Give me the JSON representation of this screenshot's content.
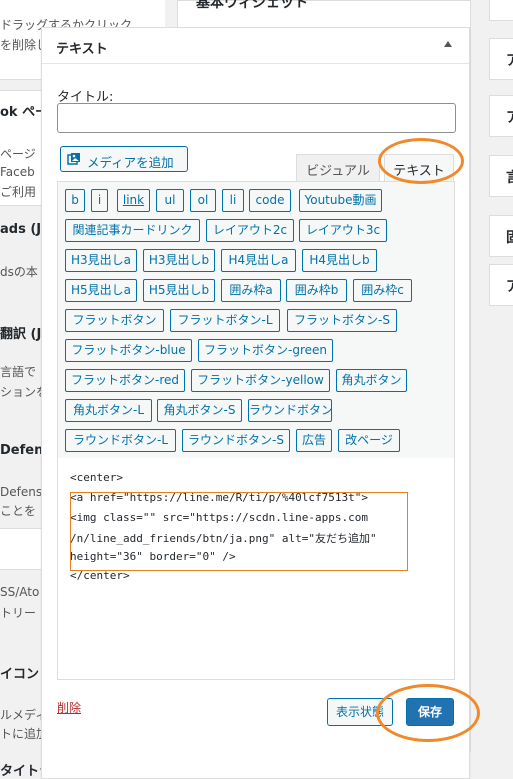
{
  "background": {
    "left_texts": [
      "ドラッグするかクリック",
      "を削除し",
      "ok ペー",
      "ページ",
      "Faceb",
      "ご利用",
      "ads (Je",
      "dsの本",
      "翻訳 (J",
      "言語で",
      "ションを",
      "Defen",
      "Defense",
      "ことを",
      "SS/Ato",
      "トリー",
      "イコン (",
      "ルメディ",
      "トに追加",
      "タイトライ"
    ],
    "middle_title": "基本ウィジェット",
    "right_letters": [
      "",
      "ア",
      "ア",
      "言",
      "固",
      "ア"
    ]
  },
  "widget": {
    "title": "テキスト",
    "title_label": "タイトル:",
    "title_value": "",
    "media_button": "メディアを追加",
    "tabs": {
      "visual": "ビジュアル",
      "text": "テキスト"
    },
    "quicktags": [
      {
        "label": "b"
      },
      {
        "label": "i"
      },
      {
        "label": "link"
      },
      {
        "label": "ul"
      },
      {
        "label": "ol"
      },
      {
        "label": "li"
      },
      {
        "label": "code"
      },
      {
        "label": "Youtube動画"
      },
      {
        "label": "関連記事カードリンク"
      },
      {
        "label": "レイアウト2c"
      },
      {
        "label": "レイアウト3c"
      },
      {
        "label": "H3見出しa"
      },
      {
        "label": "H3見出しb"
      },
      {
        "label": "H4見出しa"
      },
      {
        "label": "H4見出しb"
      },
      {
        "label": "H5見出しa"
      },
      {
        "label": "H5見出しb"
      },
      {
        "label": "囲み枠a"
      },
      {
        "label": "囲み枠b"
      },
      {
        "label": "囲み枠c"
      },
      {
        "label": "フラットボタン"
      },
      {
        "label": "フラットボタン-L"
      },
      {
        "label": "フラットボタン-S"
      },
      {
        "label": "フラットボタン-blue"
      },
      {
        "label": "フラットボタン-green"
      },
      {
        "label": "フラットボタン-red"
      },
      {
        "label": "フラットボタン-yellow"
      },
      {
        "label": "角丸ボタン"
      },
      {
        "label": "角丸ボタン-L"
      },
      {
        "label": "角丸ボタン-S"
      },
      {
        "label": "ラウンドボタン"
      },
      {
        "label": "ラウンドボタン-L"
      },
      {
        "label": "ラウンドボタン-S"
      },
      {
        "label": "広告"
      },
      {
        "label": "改ページ"
      }
    ],
    "code_lines": [
      "<center>",
      "<a href=\"https://line.me/R/ti/p/%40lcf7513t\">",
      "<img class=\"\" src=\"https://scdn.line-apps.com",
      "/n/line_add_friends/btn/ja.png\" alt=\"友だち追加\"",
      "height=\"36\" border=\"0\" />",
      "</center>"
    ],
    "delete_link": "削除",
    "preview_button": "表示状態",
    "save_button": "保存"
  },
  "colors": {
    "accent": "#0073aa",
    "save": "#2271b1",
    "annotation": "#f0892a",
    "delete": "#b32d2e"
  }
}
